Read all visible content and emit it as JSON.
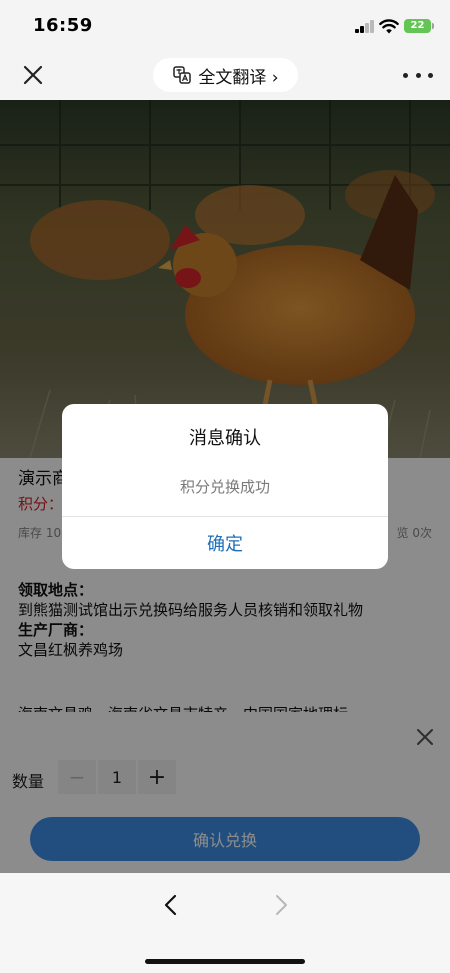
{
  "status_bar": {
    "time": "16:59",
    "battery": "22"
  },
  "nav": {
    "translate_label": "全文翻译 ›",
    "icons": {
      "close": "close-icon",
      "translate": "translate-icon",
      "more": "more-icon"
    }
  },
  "product": {
    "name": "演示商",
    "points_label": "积分：",
    "stock": "库存 10",
    "views": "览 0次"
  },
  "info": {
    "pickup_title": "领取地点：",
    "pickup_text": "到熊猫测试馆出示兑换码给服务人员核销和领取礼物",
    "manufacturer_title": "生产厂商：",
    "manufacturer_text": "文昌红枫养鸡场",
    "more_text": "海南文昌鸡，海南省文昌市特产，中国国家地理标"
  },
  "sheet": {
    "quantity_label": "数量",
    "quantity_value": "1",
    "minus": "−",
    "plus": "+",
    "confirm_button": "确认兑换"
  },
  "dialog": {
    "title": "消息确认",
    "message": "积分兑换成功",
    "ok_button": "确定"
  },
  "colors": {
    "accent_blue": "#3d8fe8",
    "dialog_link": "#1e6fb8",
    "points_red": "#d1222b",
    "battery_green": "#62c554"
  }
}
